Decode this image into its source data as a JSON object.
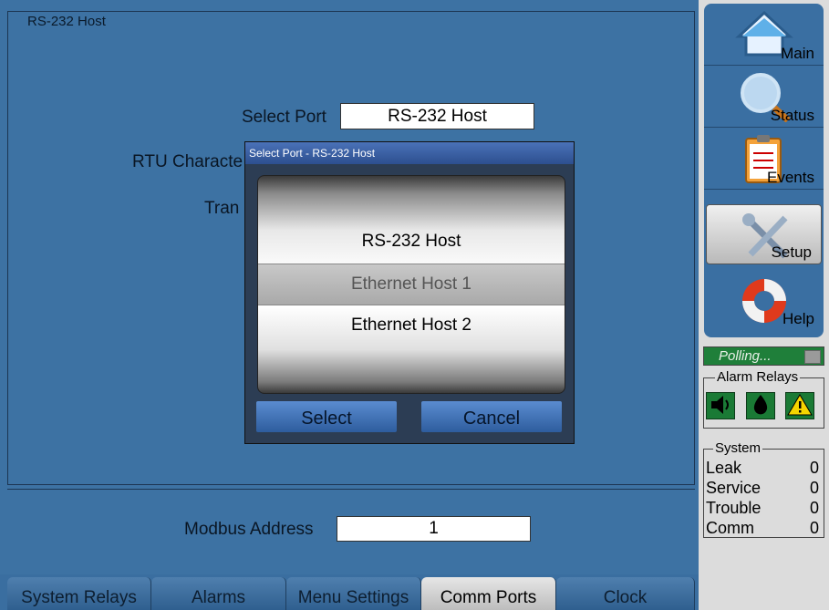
{
  "groupbox": {
    "title": "RS-232 Host"
  },
  "form": {
    "select_port_label": "Select Port",
    "select_port_value": "RS-232 Host",
    "rtu_char_label": "RTU Characte",
    "tran_label": "Tran",
    "modbus_label": "Modbus Address",
    "modbus_value": "1"
  },
  "dialog": {
    "title": "Select Port - RS-232 Host",
    "options": [
      "RS-232 Host",
      "Ethernet Host 1",
      "Ethernet Host 2"
    ],
    "selected_index": 1,
    "select_label": "Select",
    "cancel_label": "Cancel"
  },
  "tabs": [
    "System Relays",
    "Alarms",
    "Menu Settings",
    "Comm Ports",
    "Clock"
  ],
  "active_tab": "Comm Ports",
  "nav": {
    "main": "Main",
    "status": "Status",
    "events": "Events",
    "setup": "Setup",
    "help": "Help"
  },
  "active_nav": "Setup",
  "polling": "Polling...",
  "alarm_relays": {
    "title": "Alarm Relays",
    "icons": [
      "speaker-icon",
      "drop-icon",
      "warning-icon"
    ]
  },
  "system": {
    "title": "System",
    "rows": [
      {
        "label": "Leak",
        "value": "0"
      },
      {
        "label": "Service",
        "value": "0"
      },
      {
        "label": "Trouble",
        "value": "0"
      },
      {
        "label": "Comm",
        "value": "0"
      }
    ]
  },
  "colors": {
    "background": "#3d72a3",
    "sidebar": "#dcdcdc",
    "polling": "#1f7f3a",
    "alarm_icon": "#1a7a35",
    "warning": "#f5d400"
  }
}
